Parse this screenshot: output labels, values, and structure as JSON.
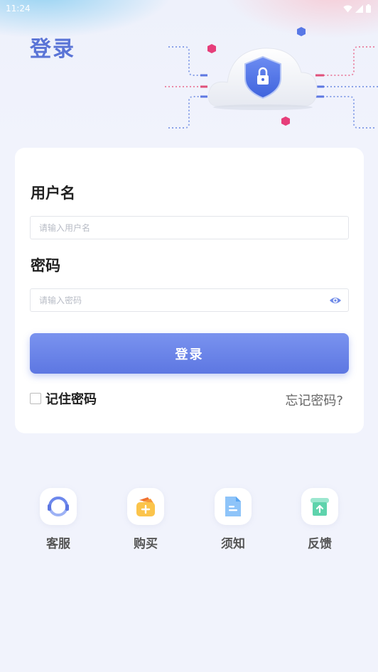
{
  "status_bar": {
    "time": "11:24"
  },
  "page_title": "登录",
  "form": {
    "username_label": "用户名",
    "username_placeholder": "请输入用户名",
    "password_label": "密码",
    "password_placeholder": "请输入密码",
    "login_button": "登录",
    "remember_label": "记住密码",
    "forgot_link": "忘记密码?"
  },
  "shortcuts": [
    {
      "label": "客服",
      "icon": "headset-icon"
    },
    {
      "label": "购买",
      "icon": "purchase-icon"
    },
    {
      "label": "须知",
      "icon": "notice-document-icon"
    },
    {
      "label": "反馈",
      "icon": "feedback-upload-icon"
    }
  ],
  "colors": {
    "accent": "#5d77e2",
    "title": "#5a74d6",
    "background": "#f1f3fc"
  }
}
